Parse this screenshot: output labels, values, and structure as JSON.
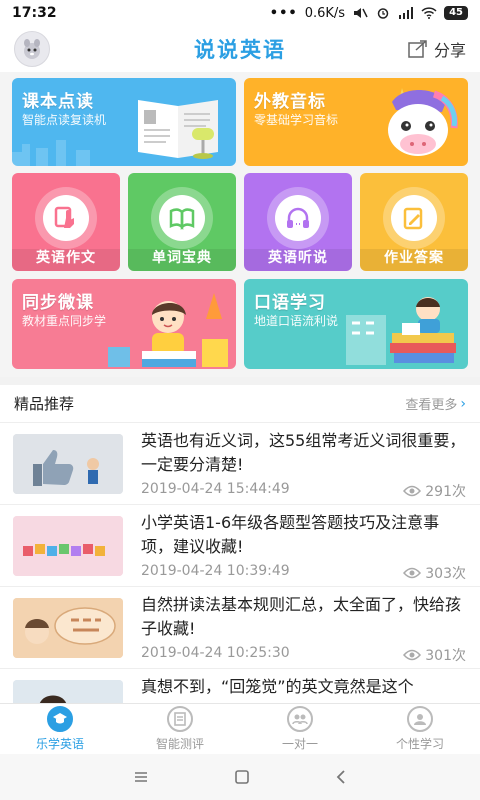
{
  "status_bar": {
    "time": "17:32",
    "dots": "•••",
    "speed": "0.6K/s",
    "battery": "45"
  },
  "header": {
    "app_title": "说说英语",
    "share_label": "分享"
  },
  "banners": {
    "textbook": {
      "title": "课本点读",
      "subtitle": "智能点读复读机",
      "color": "#4fb7ef"
    },
    "phonetic": {
      "title": "外教音标",
      "subtitle": "零基础学习音标",
      "color": "#ffb229"
    },
    "micro": {
      "title": "同步微课",
      "subtitle": "教材重点同步学",
      "color": "#f77c94"
    },
    "oral": {
      "title": "口语学习",
      "subtitle": "地道口语流利说",
      "color": "#56ccc9"
    }
  },
  "tiles": [
    {
      "label": "英语作文",
      "color": "#f9728f",
      "icon": "hand-book-icon"
    },
    {
      "label": "单词宝典",
      "color": "#5fc964",
      "icon": "open-book-icon"
    },
    {
      "label": "英语听说",
      "color": "#b273f0",
      "icon": "headphones-icon"
    },
    {
      "label": "作业答案",
      "color": "#fbbf3b",
      "icon": "pencil-paper-icon"
    }
  ],
  "recommended": {
    "title": "精品推荐",
    "more_label": "查看更多",
    "items": [
      {
        "title": "英语也有近义词，这55组常考近义词很重要，一定要分清楚!",
        "date": "2019-04-24 15:44:49",
        "views": "291次"
      },
      {
        "title": "小学英语1-6年级各题型答题技巧及注意事项，建议收藏!",
        "date": "2019-04-24 10:39:49",
        "views": "303次"
      },
      {
        "title": "自然拼读法基本规则汇总，太全面了，快给孩子收藏!",
        "date": "2019-04-24 10:25:30",
        "views": "301次"
      },
      {
        "title": "真想不到，“回笼觉”的英文竟然是这个",
        "date": "",
        "views": ""
      }
    ]
  },
  "tabbar": [
    {
      "label": "乐学英语",
      "icon": "graduation-cap-icon"
    },
    {
      "label": "智能测评",
      "icon": "document-icon"
    },
    {
      "label": "一对一",
      "icon": "people-icon"
    },
    {
      "label": "个性学习",
      "icon": "person-icon"
    }
  ],
  "colors": {
    "accent": "#2b9fe3"
  }
}
